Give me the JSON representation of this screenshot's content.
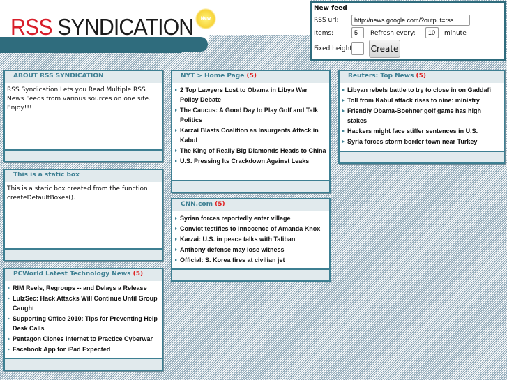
{
  "logo": {
    "part1": "RSS",
    "part2": "SYNDICATION",
    "badge": "New"
  },
  "form": {
    "title": "New feed",
    "url_label": "RSS url:",
    "url_value": "http://news.google.com/?output=rss",
    "items_label": "Items:",
    "items_value": "5",
    "refresh_label": "Refresh every:",
    "refresh_value": "10",
    "refresh_unit": "minute",
    "height_label": "Fixed height:",
    "height_value": "",
    "create_label": "Create"
  },
  "boxes": {
    "about": {
      "title": "ABOUT RSS SYNDICATION",
      "text": "RSS Syndication Lets you Read Multiple RSS News Feeds from various sources on one site. Enjoy!!!"
    },
    "static": {
      "title": "This is a static box",
      "text": "This is a static box created from the function createDefaultBoxes()."
    },
    "pcworld": {
      "title": "PCWorld Latest Technology News",
      "count": "(5)",
      "items": [
        "RIM Reels, Regroups -- and Delays a Release",
        "LulzSec: Hack Attacks Will Continue Until Group Caught",
        "Supporting Office 2010: Tips for Preventing Help Desk Calls",
        "Pentagon Clones Internet to Practice Cyberwar",
        "Facebook App for iPad Expected"
      ]
    },
    "nyt": {
      "title": "NYT > Home Page",
      "count": "(5)",
      "items": [
        "2 Top Lawyers Lost to Obama in Libya War Policy Debate",
        "The Caucus: A Good Day to Play Golf and Talk Politics",
        "Karzai Blasts Coalition as Insurgents Attack in Kabul",
        "The King of Really Big Diamonds Heads to China",
        "U.S. Pressing Its Crackdown Against Leaks"
      ]
    },
    "cnn": {
      "title": "CNN.com",
      "count": "(5)",
      "items": [
        "Syrian forces reportedly enter village",
        "Convict testifies to innocence of Amanda Knox",
        "Karzai: U.S. in peace talks with Taliban",
        "Anthony defense may lose witness",
        "Official: S. Korea fires at civilian jet"
      ]
    },
    "reuters": {
      "title": "Reuters: Top News",
      "count": "(5)",
      "items": [
        "Libyan rebels battle to try to close in on Gaddafi",
        "Toll from Kabul attack rises to nine: ministry",
        "Friendly Obama-Boehner golf game has high stakes",
        "Hackers might face stiffer sentences in U.S.",
        "Syria forces storm border town near Turkey"
      ]
    }
  }
}
